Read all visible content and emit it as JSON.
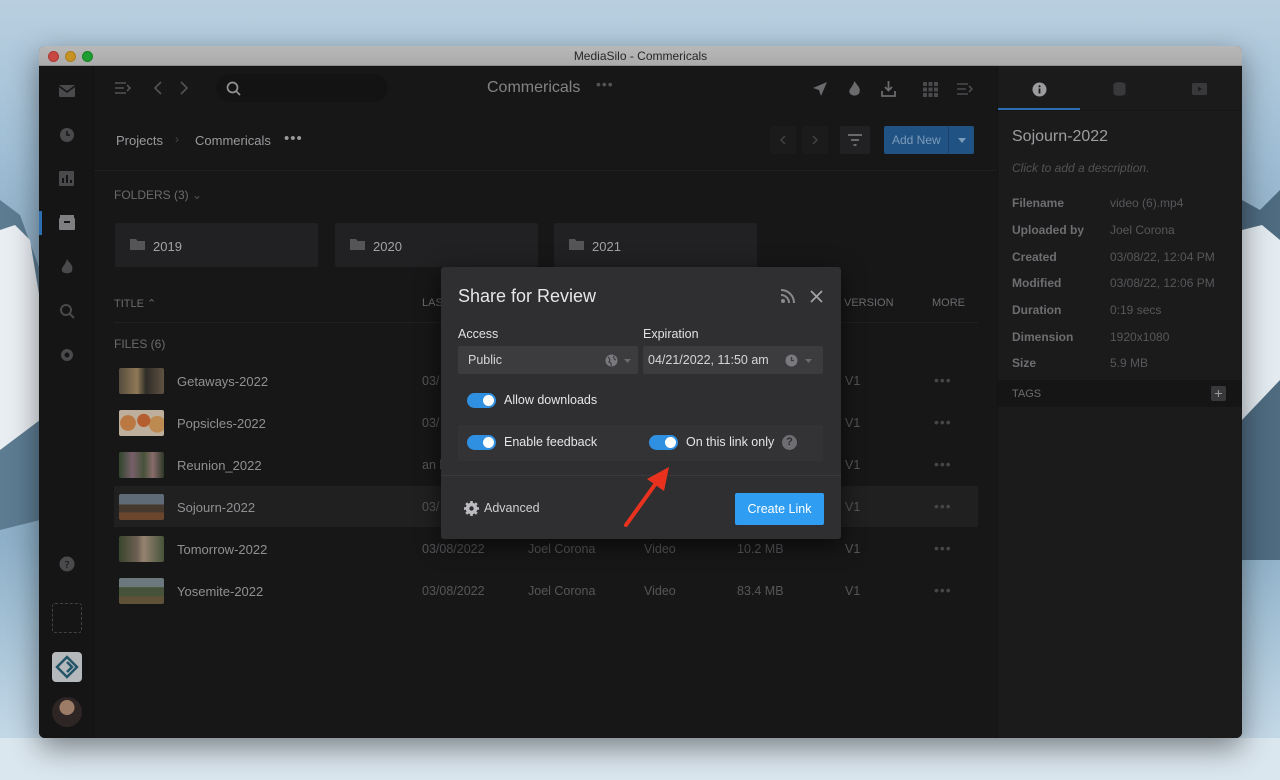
{
  "window": {
    "title": "MediaSilo - Commericals"
  },
  "toolbar": {
    "title": "Commericals",
    "search_placeholder": ""
  },
  "breadcrumb": {
    "root": "Projects",
    "current": "Commericals"
  },
  "add_new_label": "Add New",
  "folders": {
    "header": "FOLDERS (3)",
    "items": [
      {
        "name": "2019"
      },
      {
        "name": "2020"
      },
      {
        "name": "2021"
      }
    ]
  },
  "files": {
    "header": "FILES (6)",
    "columns": {
      "title": "TITLE",
      "last": "LAS",
      "version": "VERSION",
      "more": "MORE"
    },
    "rows": [
      {
        "name": "Getaways-2022",
        "date": "03/",
        "owner": "",
        "type": "",
        "size": "",
        "version": "V1"
      },
      {
        "name": "Popsicles-2022",
        "date": "03/",
        "owner": "",
        "type": "",
        "size": "",
        "version": "V1"
      },
      {
        "name": "Reunion_2022",
        "date": "an l",
        "owner": "",
        "type": "",
        "size": "",
        "version": "V1"
      },
      {
        "name": "Sojourn-2022",
        "date": "03/",
        "owner": "",
        "type": "",
        "size": "",
        "version": "V1"
      },
      {
        "name": "Tomorrow-2022",
        "date": "03/08/2022",
        "owner": "Joel Corona",
        "type": "Video",
        "size": "10.2 MB",
        "version": "V1"
      },
      {
        "name": "Yosemite-2022",
        "date": "03/08/2022",
        "owner": "Joel Corona",
        "type": "Video",
        "size": "83.4 MB",
        "version": "V1"
      }
    ]
  },
  "modal": {
    "title": "Share for Review",
    "access_label": "Access",
    "access_value": "Public",
    "expiration_label": "Expiration",
    "expiration_value": "04/21/2022, 11:50 am",
    "allow_downloads": "Allow downloads",
    "enable_feedback": "Enable feedback",
    "link_only": "On this link only",
    "advanced": "Advanced",
    "create_link": "Create Link"
  },
  "details": {
    "title": "Sojourn-2022",
    "description_placeholder": "Click to add a description.",
    "fields": [
      {
        "label": "Filename",
        "value": "video (6).mp4"
      },
      {
        "label": "Uploaded by",
        "value": "Joel Corona"
      },
      {
        "label": "Created",
        "value": "03/08/22, 12:04 PM"
      },
      {
        "label": "Modified",
        "value": "03/08/22, 12:06 PM"
      },
      {
        "label": "Duration",
        "value": "0:19 secs"
      },
      {
        "label": "Dimension",
        "value": "1920x1080"
      },
      {
        "label": "Size",
        "value": "5.9 MB"
      }
    ],
    "tags_label": "TAGS"
  },
  "colors": {
    "accent": "#3a8ee6",
    "create_button": "#2e9df2",
    "annotation_arrow": "#e8321e"
  }
}
